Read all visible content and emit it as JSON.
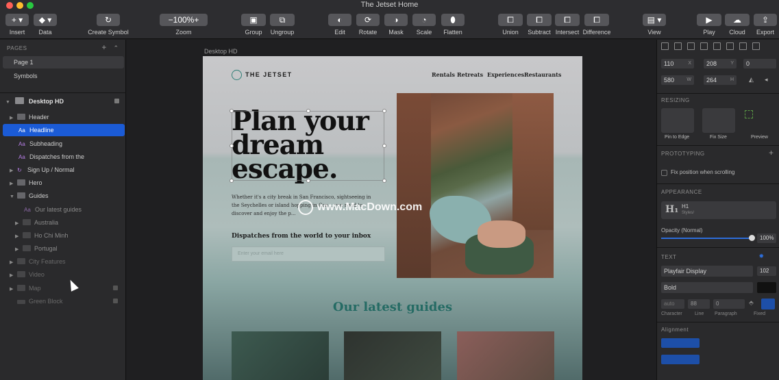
{
  "window": {
    "title": "The Jetset Home"
  },
  "toolbar": {
    "insert": "Insert",
    "data": "Data",
    "create_symbol": "Create Symbol",
    "zoom": "Zoom",
    "zoom_value": "100%",
    "zoom_minus": "−",
    "zoom_plus": "+",
    "group": "Group",
    "ungroup": "Ungroup",
    "edit": "Edit",
    "rotate": "Rotate",
    "mask": "Mask",
    "scale": "Scale",
    "flatten": "Flatten",
    "union": "Union",
    "subtract": "Subtract",
    "intersect": "Intersect",
    "difference": "Difference",
    "view": "View",
    "play": "Play",
    "cloud": "Cloud",
    "export": "Export"
  },
  "left_panel": {
    "pages_header": "PAGES",
    "pages": [
      "Page 1",
      "Symbols"
    ],
    "artboard": "Desktop HD",
    "layers": [
      "Header",
      "Headline",
      "Subheading",
      "Dispatches from the",
      "Sign Up / Normal",
      "Hero",
      "Guides",
      "Our latest guides",
      "Australia",
      "Ho Chi Minh",
      "Portugal",
      "City Features",
      "Video",
      "Map",
      "Green Block"
    ]
  },
  "canvas": {
    "artboard_label": "Desktop HD",
    "logo": "THE JETSET",
    "nav": [
      "Rentals",
      "Retreats",
      "Experiences",
      "Restaurants"
    ],
    "headline_lines": [
      "Plan your",
      "dream",
      "escape."
    ],
    "subheading": "Whether it's a city break in San Francisco, sightseeing in the Seychelles or island hopping in Con... you need to discover and enjoy the p...",
    "dispatch": "Dispatches from the world to your inbox",
    "email_placeholder": "Enter your email here",
    "guides_title": "Our latest guides",
    "watermark": "www.MacDown.com"
  },
  "inspector": {
    "x": "110",
    "x_suffix": "X",
    "y": "208",
    "y_suffix": "Y",
    "rotation": "0",
    "w": "580",
    "w_suffix": "W",
    "h": "264",
    "h_suffix": "H",
    "resizing": "RESIZING",
    "pin_to_edge": "Pin to Edge",
    "fix_size": "Fix Size",
    "preview": "Preview",
    "prototyping": "PROTOTYPING",
    "fix_position": "Fix position when scrolling",
    "appearance": "APPEARANCE",
    "style_glyph": "H₁",
    "style_name": "H1",
    "style_sub": "Styles/",
    "opacity_label": "Opacity (Normal)",
    "opacity_value": "100%",
    "text": "TEXT",
    "font_family": "Playfair Display",
    "font_size": "102",
    "font_weight": "Bold",
    "char_value": "auto",
    "line_value": "88",
    "para_value": "0",
    "character": "Character",
    "line": "Line",
    "paragraph": "Paragraph",
    "fixed": "Fixed",
    "alignment": "Alignment"
  }
}
